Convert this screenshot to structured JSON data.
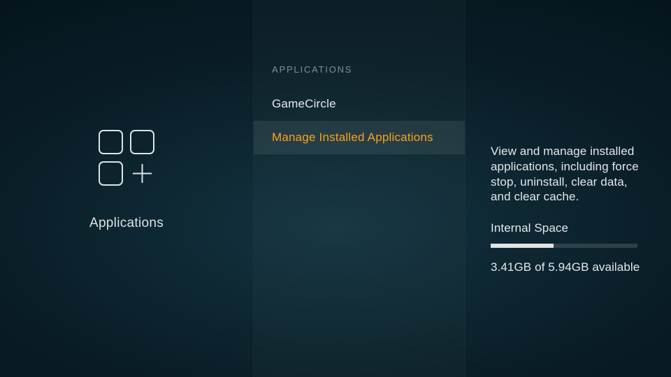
{
  "left": {
    "title": "Applications"
  },
  "middle": {
    "header": "APPLICATIONS",
    "items": [
      {
        "label": "GameCircle",
        "selected": false
      },
      {
        "label": "Manage Installed Applications",
        "selected": true
      }
    ]
  },
  "right": {
    "description": "View and manage installed applications, including force stop, uninstall, clear data, and clear cache.",
    "storage_label": "Internal Space",
    "storage_used_gb": 3.41,
    "storage_total_gb": 5.94,
    "storage_fill_percent": 43,
    "storage_text": "3.41GB of 5.94GB available"
  }
}
